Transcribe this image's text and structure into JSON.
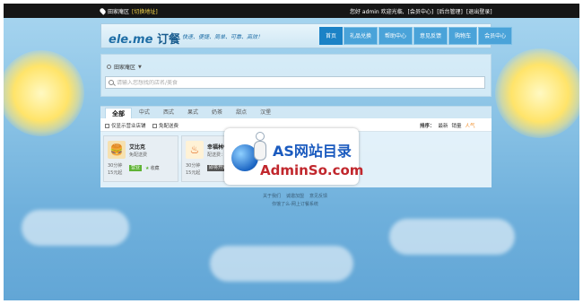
{
  "topbar": {
    "location": "田家庵区",
    "switch_label": "[切换地址]",
    "greeting": "您好 admin 欢迎光临,",
    "links": [
      "[会员中心]",
      "[后台管理]",
      "[退出登录]"
    ]
  },
  "header": {
    "logo": "ele.me",
    "logo_cn": "订餐",
    "slogan": "快速、便捷、简单、可靠、高效！",
    "nav": [
      "首页",
      "礼品兑换",
      "帮助中心",
      "意见反馈",
      "购物车",
      "会员中心"
    ]
  },
  "search": {
    "area": "田家庵区",
    "placeholder": "请输入您想找的店名/美食"
  },
  "categories": [
    "全部",
    "中式",
    "西式",
    "果式",
    "奶茶",
    "甜点",
    "汉堡"
  ],
  "filters": {
    "open_only": "仅显示营业店铺",
    "free_delivery": "免配送费",
    "sort_label": "排序：",
    "sort_options": [
      "最新",
      "销量",
      "人气"
    ]
  },
  "restaurants": [
    {
      "name": "艾比克",
      "delivery": "免配送费",
      "time": "30分钟",
      "minimum": "15元起",
      "status": "营业",
      "fav": "收藏"
    },
    {
      "name": "幸福林餐厅",
      "delivery": "配送费：1",
      "time": "30分钟",
      "minimum": "15元起",
      "status": "即将开始"
    }
  ],
  "watermark": {
    "title": "AS网站目录",
    "sub": "AdminSo.com"
  },
  "footer": {
    "links": [
      "关于我们",
      "诚邀加盟",
      "意见反馈"
    ],
    "copyright": "你饿了么-网上订餐系统"
  },
  "colors": {
    "accent": "#1b82c6",
    "topbar": "#161616",
    "open_badge": "#5fb336",
    "soon_badge": "#555555",
    "sort_selected": "#f08a24"
  }
}
